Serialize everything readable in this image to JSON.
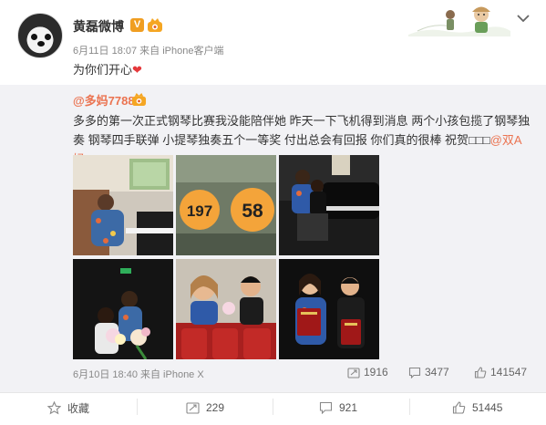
{
  "post": {
    "author": "黄磊微博",
    "vip_badge": "V",
    "meta": "6月11日 18:07 来自 iPhone客户端",
    "text": "为你们开心",
    "heart": "❤"
  },
  "repost": {
    "author": "@多妈7788",
    "text_before_mention": "多多的第一次正式钢琴比赛我没能陪伴她 昨天一下飞机得到消息 两个小孩包揽了钢琴独奏 钢琴四手联弹 小提琴独奏五个一等奖 付出总会有回报 你们真的很棒 祝贺□□□",
    "mention": "@双A妈",
    "photo_numbers": [
      "197",
      "58"
    ],
    "meta": "6月10日 18:40 来自 iPhone X",
    "stats": {
      "forward": "1916",
      "comment": "3477",
      "like": "141547"
    }
  },
  "actions": {
    "favorite": "收藏",
    "forward": "229",
    "comment": "921",
    "like": "51445"
  },
  "icons": [
    "vip-badge",
    "member-crown-icon",
    "chevron-down-icon",
    "share-icon",
    "comment-icon",
    "thumbs-up-icon",
    "star-icon"
  ],
  "colors": {
    "accent": "#eb7350",
    "repost_bg": "#f2f2f5",
    "heart": "#e5383b",
    "vip": "#f09e21"
  }
}
